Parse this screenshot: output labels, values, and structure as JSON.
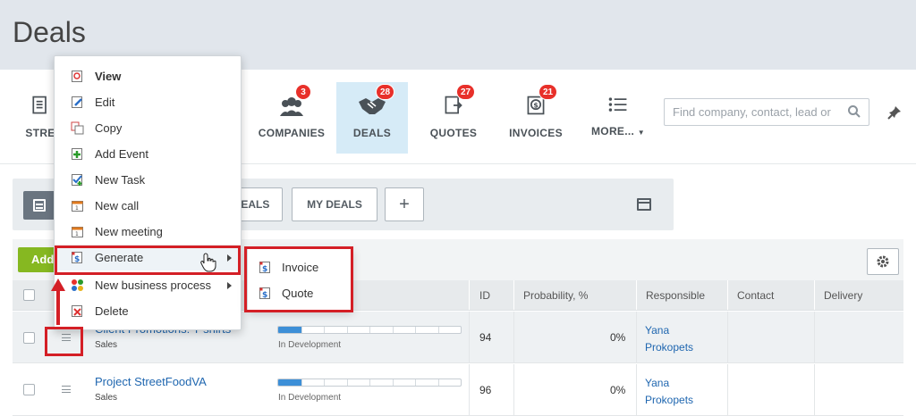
{
  "page": {
    "title": "Deals"
  },
  "nav": {
    "items": [
      {
        "key": "stream",
        "label": "STRE",
        "icon": "stream-icon",
        "badge": null
      },
      {
        "key": "companies",
        "label": "COMPANIES",
        "icon": "companies-icon",
        "badge": "3"
      },
      {
        "key": "deals",
        "label": "DEALS",
        "icon": "handshake-icon",
        "badge": "28"
      },
      {
        "key": "quotes",
        "label": "QUOTES",
        "icon": "quote-icon",
        "badge": "27"
      },
      {
        "key": "invoices",
        "label": "INVOICES",
        "icon": "invoice-icon",
        "badge": "21"
      },
      {
        "key": "more",
        "label": "MORE...",
        "icon": "list-icon",
        "badge": null
      }
    ],
    "active": "deals"
  },
  "search": {
    "placeholder": "Find company, contact, lead or"
  },
  "filters": {
    "deals_tab_label": "DEALS",
    "my_deals_label": "MY DEALS",
    "add_label": "+"
  },
  "toolbar": {
    "add_label": "Add"
  },
  "grid": {
    "columns": [
      "ID",
      "Probability, %",
      "Responsible",
      "Contact",
      "Delivery"
    ],
    "rows": [
      {
        "name": "Client Promotions: T-shirts",
        "category": "Sales",
        "stage": "In Development",
        "stage_progress": 0.125,
        "id": "94",
        "probability": "0%",
        "responsible_first": "Yana",
        "responsible_last": "Prokopets"
      },
      {
        "name": "Project StreetFoodVA",
        "category": "Sales",
        "stage": "In Development",
        "stage_progress": 0.125,
        "id": "96",
        "probability": "0%",
        "responsible_first": "Yana",
        "responsible_last": "Prokopets"
      }
    ]
  },
  "context_menu": {
    "items": [
      {
        "label": "View",
        "icon": "view-icon",
        "bold": true
      },
      {
        "label": "Edit",
        "icon": "edit-icon"
      },
      {
        "label": "Copy",
        "icon": "copy-icon"
      },
      {
        "label": "Add Event",
        "icon": "add-event-icon"
      },
      {
        "label": "New Task",
        "icon": "task-icon"
      },
      {
        "label": "New call",
        "icon": "call-icon"
      },
      {
        "label": "New meeting",
        "icon": "meeting-icon"
      },
      {
        "label": "Generate",
        "icon": "generate-icon",
        "submenu": true
      },
      {
        "label": "New business process",
        "icon": "business-process-icon",
        "submenu": true
      },
      {
        "label": "Delete",
        "icon": "delete-icon"
      }
    ]
  },
  "generate_submenu": {
    "items": [
      {
        "label": "Invoice",
        "icon": "invoice-doc-icon"
      },
      {
        "label": "Quote",
        "icon": "quote-doc-icon"
      }
    ]
  },
  "colors": {
    "accent": "#2067b0",
    "active_tab": "#d6ebf7",
    "badge": "#e8302a",
    "highlight": "#d41f26",
    "add_button": "#86b821"
  }
}
